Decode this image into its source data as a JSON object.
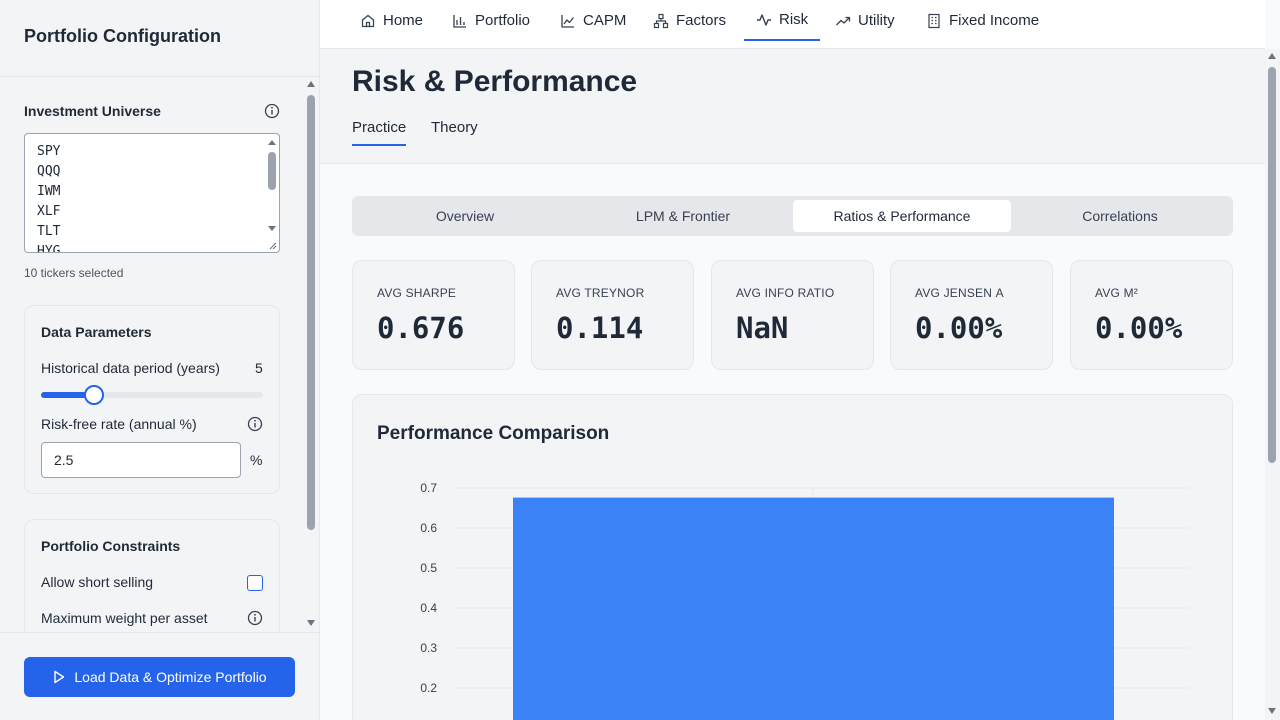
{
  "sidebar": {
    "title": "Portfolio Configuration",
    "universe_label": "Investment Universe",
    "tickers": [
      "SPY",
      "QQQ",
      "IWM",
      "XLF",
      "TLT",
      "HYG"
    ],
    "tickers_count": "10 tickers selected",
    "data_params": {
      "title": "Data Parameters",
      "period_label": "Historical data period (years)",
      "period_value": "5",
      "period_fraction": 0.24,
      "rf_label": "Risk-free rate (annual %)",
      "rf_value": "2.5",
      "rf_unit": "%"
    },
    "constraints": {
      "title": "Portfolio Constraints",
      "short_label": "Allow short selling",
      "short_checked": false,
      "max_weight_label": "Maximum weight per asset"
    },
    "cta_label": "Load Data & Optimize Portfolio"
  },
  "nav": {
    "items": [
      {
        "label": "Home",
        "icon": "home-icon"
      },
      {
        "label": "Portfolio",
        "icon": "bar-chart-icon"
      },
      {
        "label": "CAPM",
        "icon": "line-chart-icon"
      },
      {
        "label": "Factors",
        "icon": "network-icon"
      },
      {
        "label": "Risk",
        "icon": "activity-icon"
      },
      {
        "label": "Utility",
        "icon": "trending-up-icon"
      },
      {
        "label": "Fixed Income",
        "icon": "building-icon"
      }
    ],
    "active": "Risk"
  },
  "page": {
    "title": "Risk & Performance",
    "subtabs": [
      "Practice",
      "Theory"
    ],
    "active_subtab": "Practice"
  },
  "segments": {
    "items": [
      "Overview",
      "LPM & Frontier",
      "Ratios & Performance",
      "Correlations"
    ],
    "active": "Ratios & Performance"
  },
  "kpis": [
    {
      "label": "AVG SHARPE",
      "value": "0.676"
    },
    {
      "label": "AVG TREYNOR",
      "value": "0.114"
    },
    {
      "label": "AVG INFO RATIO",
      "value": "NaN"
    },
    {
      "label": "AVG JENSEN Α",
      "value": "0.00%"
    },
    {
      "label": "AVG M²",
      "value": "0.00%"
    }
  ],
  "colors": {
    "accent": "#2563eb",
    "bar": "#3b82f6"
  },
  "chart_data": {
    "type": "bar",
    "title": "Performance Comparison",
    "categories": [
      ""
    ],
    "values": [
      0.676
    ],
    "ylim": [
      0,
      0.7
    ],
    "yticks": [
      "0.7",
      "0.6",
      "0.5",
      "0.4",
      "0.3",
      "0.2"
    ],
    "grid": true
  }
}
